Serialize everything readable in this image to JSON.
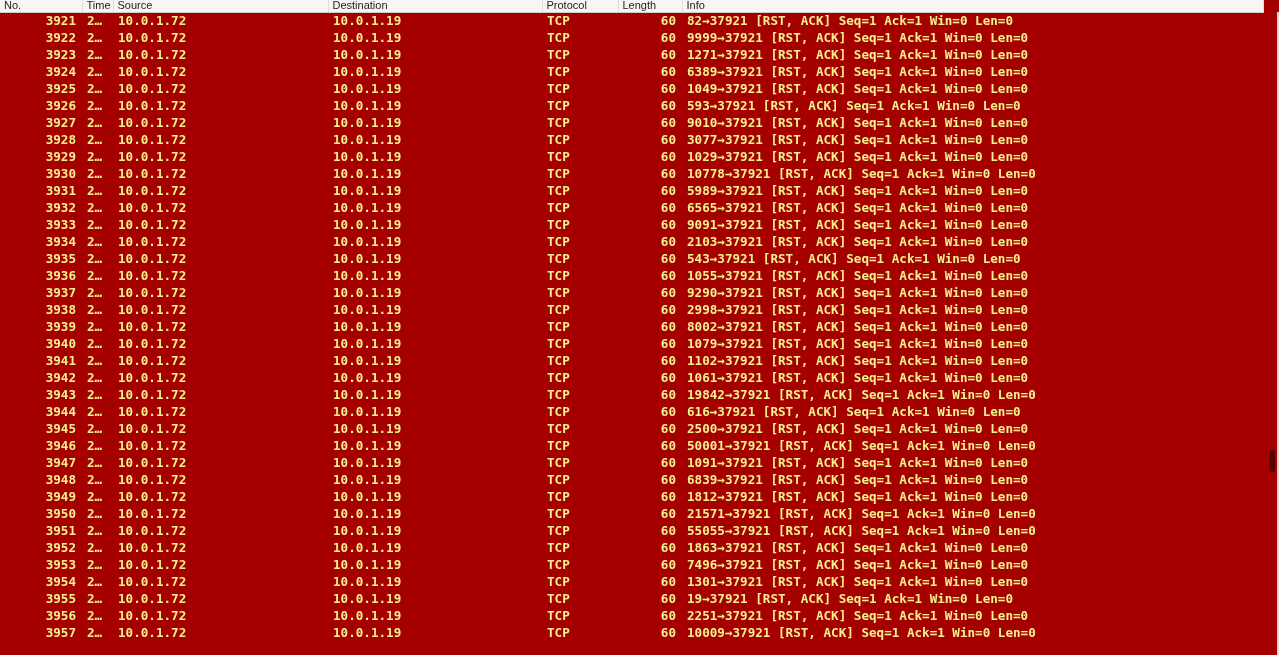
{
  "table": {
    "columns": [
      "No.",
      "Time",
      "Source",
      "Destination",
      "Protocol",
      "Length",
      "Info"
    ],
    "rows": [
      [
        "3921",
        "2…",
        "10.0.1.72",
        "10.0.1.19",
        "TCP",
        "60",
        "82→37921 [RST, ACK] Seq=1 Ack=1 Win=0 Len=0"
      ],
      [
        "3922",
        "2…",
        "10.0.1.72",
        "10.0.1.19",
        "TCP",
        "60",
        "9999→37921 [RST, ACK] Seq=1 Ack=1 Win=0 Len=0"
      ],
      [
        "3923",
        "2…",
        "10.0.1.72",
        "10.0.1.19",
        "TCP",
        "60",
        "1271→37921 [RST, ACK] Seq=1 Ack=1 Win=0 Len=0"
      ],
      [
        "3924",
        "2…",
        "10.0.1.72",
        "10.0.1.19",
        "TCP",
        "60",
        "6389→37921 [RST, ACK] Seq=1 Ack=1 Win=0 Len=0"
      ],
      [
        "3925",
        "2…",
        "10.0.1.72",
        "10.0.1.19",
        "TCP",
        "60",
        "1049→37921 [RST, ACK] Seq=1 Ack=1 Win=0 Len=0"
      ],
      [
        "3926",
        "2…",
        "10.0.1.72",
        "10.0.1.19",
        "TCP",
        "60",
        "593→37921 [RST, ACK] Seq=1 Ack=1 Win=0 Len=0"
      ],
      [
        "3927",
        "2…",
        "10.0.1.72",
        "10.0.1.19",
        "TCP",
        "60",
        "9010→37921 [RST, ACK] Seq=1 Ack=1 Win=0 Len=0"
      ],
      [
        "3928",
        "2…",
        "10.0.1.72",
        "10.0.1.19",
        "TCP",
        "60",
        "3077→37921 [RST, ACK] Seq=1 Ack=1 Win=0 Len=0"
      ],
      [
        "3929",
        "2…",
        "10.0.1.72",
        "10.0.1.19",
        "TCP",
        "60",
        "1029→37921 [RST, ACK] Seq=1 Ack=1 Win=0 Len=0"
      ],
      [
        "3930",
        "2…",
        "10.0.1.72",
        "10.0.1.19",
        "TCP",
        "60",
        "10778→37921 [RST, ACK] Seq=1 Ack=1 Win=0 Len=0"
      ],
      [
        "3931",
        "2…",
        "10.0.1.72",
        "10.0.1.19",
        "TCP",
        "60",
        "5989→37921 [RST, ACK] Seq=1 Ack=1 Win=0 Len=0"
      ],
      [
        "3932",
        "2…",
        "10.0.1.72",
        "10.0.1.19",
        "TCP",
        "60",
        "6565→37921 [RST, ACK] Seq=1 Ack=1 Win=0 Len=0"
      ],
      [
        "3933",
        "2…",
        "10.0.1.72",
        "10.0.1.19",
        "TCP",
        "60",
        "9091→37921 [RST, ACK] Seq=1 Ack=1 Win=0 Len=0"
      ],
      [
        "3934",
        "2…",
        "10.0.1.72",
        "10.0.1.19",
        "TCP",
        "60",
        "2103→37921 [RST, ACK] Seq=1 Ack=1 Win=0 Len=0"
      ],
      [
        "3935",
        "2…",
        "10.0.1.72",
        "10.0.1.19",
        "TCP",
        "60",
        "543→37921 [RST, ACK] Seq=1 Ack=1 Win=0 Len=0"
      ],
      [
        "3936",
        "2…",
        "10.0.1.72",
        "10.0.1.19",
        "TCP",
        "60",
        "1055→37921 [RST, ACK] Seq=1 Ack=1 Win=0 Len=0"
      ],
      [
        "3937",
        "2…",
        "10.0.1.72",
        "10.0.1.19",
        "TCP",
        "60",
        "9290→37921 [RST, ACK] Seq=1 Ack=1 Win=0 Len=0"
      ],
      [
        "3938",
        "2…",
        "10.0.1.72",
        "10.0.1.19",
        "TCP",
        "60",
        "2998→37921 [RST, ACK] Seq=1 Ack=1 Win=0 Len=0"
      ],
      [
        "3939",
        "2…",
        "10.0.1.72",
        "10.0.1.19",
        "TCP",
        "60",
        "8002→37921 [RST, ACK] Seq=1 Ack=1 Win=0 Len=0"
      ],
      [
        "3940",
        "2…",
        "10.0.1.72",
        "10.0.1.19",
        "TCP",
        "60",
        "1079→37921 [RST, ACK] Seq=1 Ack=1 Win=0 Len=0"
      ],
      [
        "3941",
        "2…",
        "10.0.1.72",
        "10.0.1.19",
        "TCP",
        "60",
        "1102→37921 [RST, ACK] Seq=1 Ack=1 Win=0 Len=0"
      ],
      [
        "3942",
        "2…",
        "10.0.1.72",
        "10.0.1.19",
        "TCP",
        "60",
        "1061→37921 [RST, ACK] Seq=1 Ack=1 Win=0 Len=0"
      ],
      [
        "3943",
        "2…",
        "10.0.1.72",
        "10.0.1.19",
        "TCP",
        "60",
        "19842→37921 [RST, ACK] Seq=1 Ack=1 Win=0 Len=0"
      ],
      [
        "3944",
        "2…",
        "10.0.1.72",
        "10.0.1.19",
        "TCP",
        "60",
        "616→37921 [RST, ACK] Seq=1 Ack=1 Win=0 Len=0"
      ],
      [
        "3945",
        "2…",
        "10.0.1.72",
        "10.0.1.19",
        "TCP",
        "60",
        "2500→37921 [RST, ACK] Seq=1 Ack=1 Win=0 Len=0"
      ],
      [
        "3946",
        "2…",
        "10.0.1.72",
        "10.0.1.19",
        "TCP",
        "60",
        "50001→37921 [RST, ACK] Seq=1 Ack=1 Win=0 Len=0"
      ],
      [
        "3947",
        "2…",
        "10.0.1.72",
        "10.0.1.19",
        "TCP",
        "60",
        "1091→37921 [RST, ACK] Seq=1 Ack=1 Win=0 Len=0"
      ],
      [
        "3948",
        "2…",
        "10.0.1.72",
        "10.0.1.19",
        "TCP",
        "60",
        "6839→37921 [RST, ACK] Seq=1 Ack=1 Win=0 Len=0"
      ],
      [
        "3949",
        "2…",
        "10.0.1.72",
        "10.0.1.19",
        "TCP",
        "60",
        "1812→37921 [RST, ACK] Seq=1 Ack=1 Win=0 Len=0"
      ],
      [
        "3950",
        "2…",
        "10.0.1.72",
        "10.0.1.19",
        "TCP",
        "60",
        "21571→37921 [RST, ACK] Seq=1 Ack=1 Win=0 Len=0"
      ],
      [
        "3951",
        "2…",
        "10.0.1.72",
        "10.0.1.19",
        "TCP",
        "60",
        "55055→37921 [RST, ACK] Seq=1 Ack=1 Win=0 Len=0"
      ],
      [
        "3952",
        "2…",
        "10.0.1.72",
        "10.0.1.19",
        "TCP",
        "60",
        "1863→37921 [RST, ACK] Seq=1 Ack=1 Win=0 Len=0"
      ],
      [
        "3953",
        "2…",
        "10.0.1.72",
        "10.0.1.19",
        "TCP",
        "60",
        "7496→37921 [RST, ACK] Seq=1 Ack=1 Win=0 Len=0"
      ],
      [
        "3954",
        "2…",
        "10.0.1.72",
        "10.0.1.19",
        "TCP",
        "60",
        "1301→37921 [RST, ACK] Seq=1 Ack=1 Win=0 Len=0"
      ],
      [
        "3955",
        "2…",
        "10.0.1.72",
        "10.0.1.19",
        "TCP",
        "60",
        "19→37921 [RST, ACK] Seq=1 Ack=1 Win=0 Len=0"
      ],
      [
        "3956",
        "2…",
        "10.0.1.72",
        "10.0.1.19",
        "TCP",
        "60",
        "2251→37921 [RST, ACK] Seq=1 Ack=1 Win=0 Len=0"
      ],
      [
        "3957",
        "2…",
        "10.0.1.72",
        "10.0.1.19",
        "TCP",
        "60",
        "10009→37921 [RST, ACK] Seq=1 Ack=1 Win=0 Len=0"
      ]
    ]
  }
}
